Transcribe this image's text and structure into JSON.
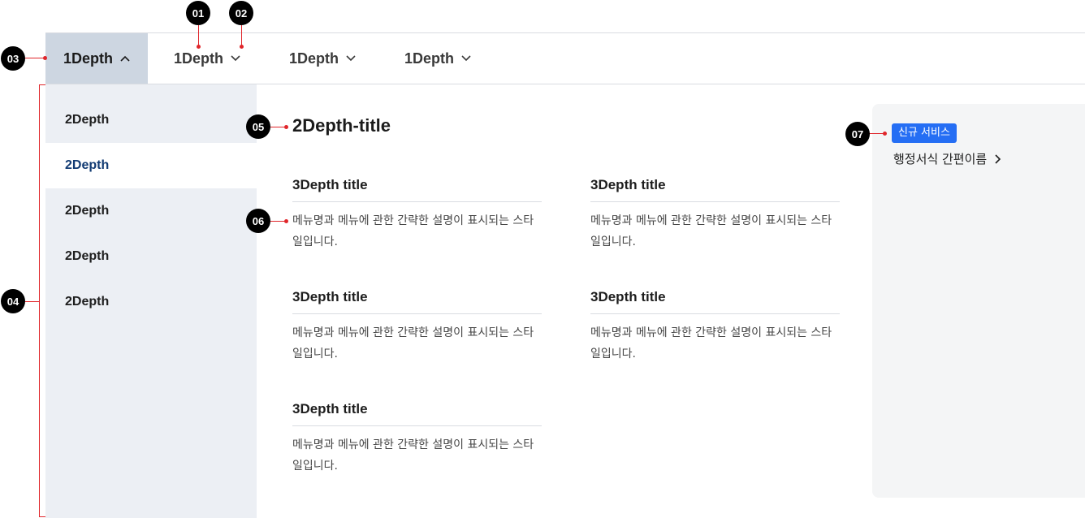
{
  "nav": {
    "items": [
      {
        "label": "1Depth",
        "expanded": true,
        "icon": "chevron-up-icon"
      },
      {
        "label": "1Depth",
        "expanded": false,
        "icon": "chevron-down-icon"
      },
      {
        "label": "1Depth",
        "expanded": false,
        "icon": "chevron-down-icon"
      },
      {
        "label": "1Depth",
        "expanded": false,
        "icon": "chevron-down-icon"
      }
    ],
    "active_bg": "#cdd6e1"
  },
  "sidebar": {
    "items": [
      {
        "label": "2Depth",
        "selected": false
      },
      {
        "label": "2Depth",
        "selected": true
      },
      {
        "label": "2Depth",
        "selected": false
      },
      {
        "label": "2Depth",
        "selected": false
      },
      {
        "label": "2Depth",
        "selected": false
      }
    ],
    "selected_color": "#123b73"
  },
  "content": {
    "title": "2Depth-title",
    "cards": [
      {
        "title": "3Depth title",
        "desc": "메뉴명과 메뉴에 관한 간략한 설명이 표시되는 스타일입니다."
      },
      {
        "title": "3Depth title",
        "desc": "메뉴명과 메뉴에 관한 간략한 설명이 표시되는 스타일입니다."
      },
      {
        "title": "3Depth title",
        "desc": "메뉴명과 메뉴에 관한 간략한 설명이 표시되는 스타일입니다."
      },
      {
        "title": "3Depth title",
        "desc": "메뉴명과 메뉴에 관한 간략한 설명이 표시되는 스타일입니다."
      },
      {
        "title": "3Depth title",
        "desc": "메뉴명과 메뉴에 관한 간략한 설명이 표시되는 스타일입니다."
      }
    ]
  },
  "panel": {
    "badge": "신규 서비스",
    "badge_color": "#256ef4",
    "link": "행정서식 간편이름",
    "link_icon": "chevron-right-icon"
  },
  "annotations": [
    "01",
    "02",
    "03",
    "04",
    "05",
    "06",
    "07"
  ],
  "annotation_line_color": "#e0262b"
}
